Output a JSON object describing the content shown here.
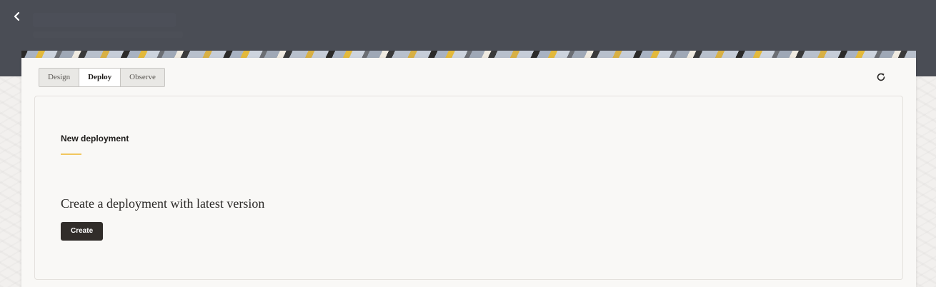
{
  "header": {
    "back_icon": "chevron-left-icon"
  },
  "tabs": [
    {
      "label": "Design",
      "selected": false
    },
    {
      "label": "Deploy",
      "selected": true
    },
    {
      "label": "Observe",
      "selected": false
    }
  ],
  "toolbar": {
    "refresh_icon": "refresh-icon"
  },
  "deployment": {
    "section_title": "New deployment",
    "heading": "Create a deployment with latest version",
    "create_label": "Create"
  },
  "colors": {
    "header_bg": "#4a4d55",
    "accent": "#f1c65e",
    "primary_button": "#312d2a"
  }
}
